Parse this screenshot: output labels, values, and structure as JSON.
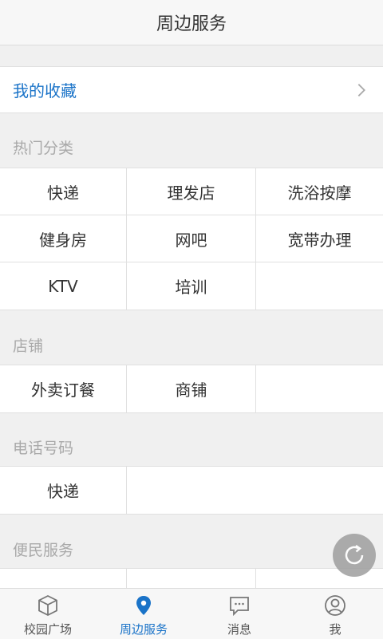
{
  "header": {
    "title": "周边服务"
  },
  "favorites": {
    "label": "我的收藏"
  },
  "sections": {
    "hot": {
      "title": "热门分类",
      "items": [
        "快递",
        "理发店",
        "洗浴按摩",
        "健身房",
        "网吧",
        "宽带办理",
        "KTV",
        "培训",
        ""
      ]
    },
    "shops": {
      "title": "店铺",
      "items": [
        "外卖订餐",
        "商铺",
        ""
      ]
    },
    "phone": {
      "title": "电话号码",
      "items": [
        "快递"
      ]
    },
    "convenience": {
      "title": "便民服务"
    }
  },
  "tabbar": {
    "tabs": [
      {
        "label": "校园广场",
        "icon": "cube-icon"
      },
      {
        "label": "周边服务",
        "icon": "location-pin-icon",
        "active": true
      },
      {
        "label": "消息",
        "icon": "message-icon"
      },
      {
        "label": "我",
        "icon": "user-icon"
      }
    ]
  },
  "colors": {
    "accent": "#1a73c8",
    "background": "#f0f0f0",
    "section_title": "#a9a9a9"
  }
}
